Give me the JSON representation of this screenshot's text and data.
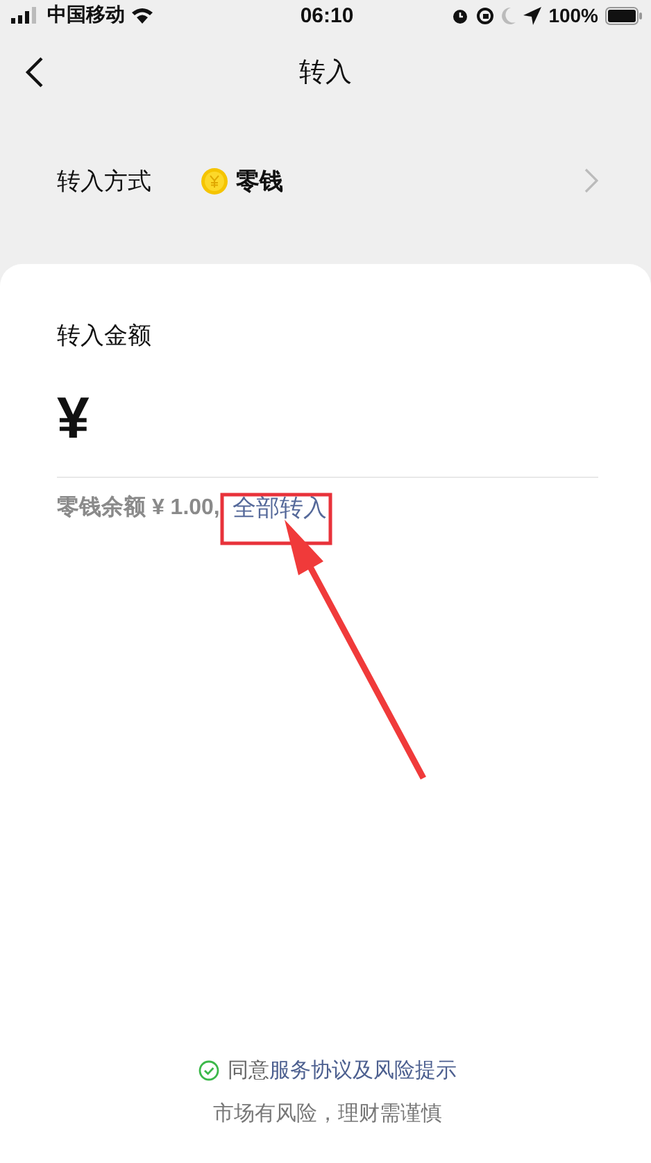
{
  "status_bar": {
    "carrier": "中国移动",
    "time": "06:10",
    "battery": "100%"
  },
  "nav": {
    "title": "转入"
  },
  "method": {
    "label": "转入方式",
    "value": "零钱"
  },
  "amount": {
    "label": "转入金额",
    "currency": "¥"
  },
  "balance": {
    "text": "零钱余额 ¥ 1.00,",
    "link": "全部转入"
  },
  "agreement": {
    "checked": true,
    "prefix": "同意",
    "link": "服务协议及风险提示"
  },
  "notice": "市场有风险，理财需谨慎"
}
